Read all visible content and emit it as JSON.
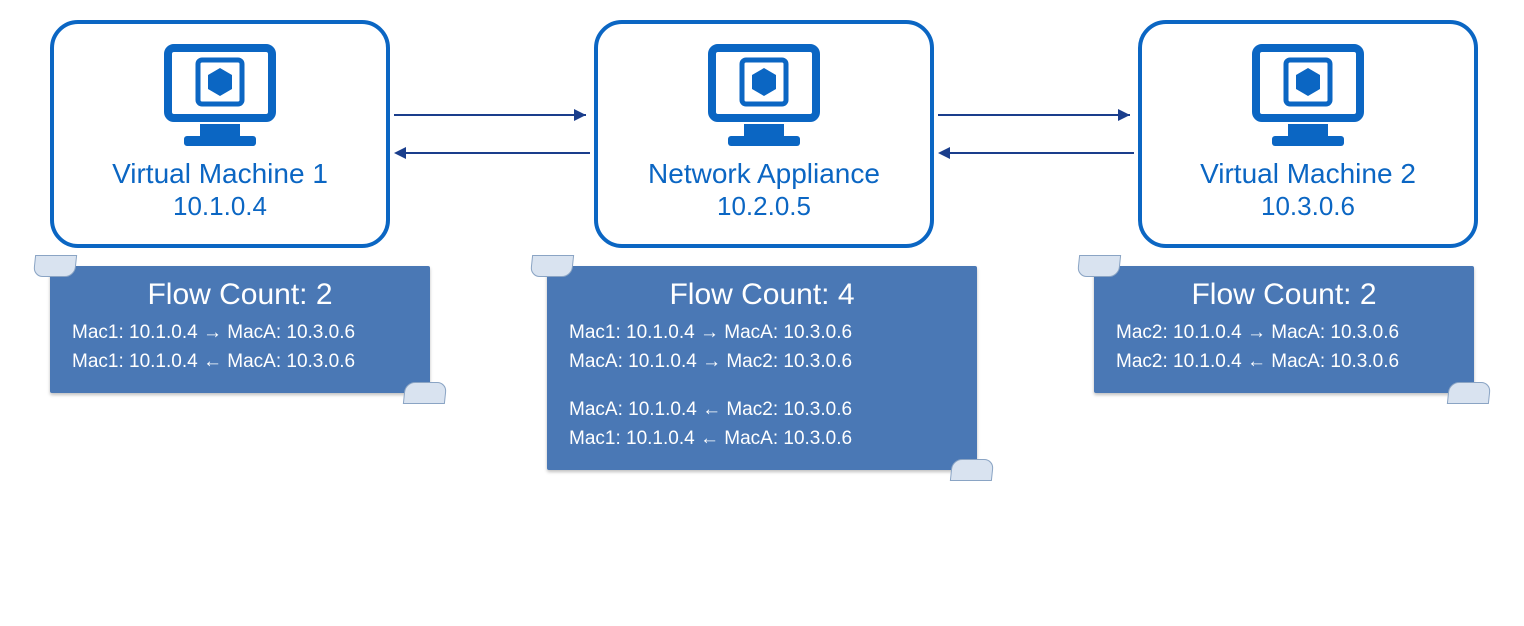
{
  "nodes": {
    "vm1": {
      "title": "Virtual Machine 1",
      "ip": "10.1.0.4"
    },
    "appliance": {
      "title": "Network Appliance",
      "ip": "10.2.0.5"
    },
    "vm2": {
      "title": "Virtual Machine 2",
      "ip": "10.3.0.6"
    }
  },
  "flows": {
    "vm1": {
      "heading": "Flow Count: 2",
      "lines": [
        {
          "left": "Mac1: 10.1.0.4",
          "dir": "→",
          "right": "MacA: 10.3.0.6"
        },
        {
          "left": "Mac1: 10.1.0.4",
          "dir": "←",
          "right": "MacA: 10.3.0.6"
        }
      ]
    },
    "appliance": {
      "heading": "Flow Count: 4",
      "lines_a": [
        {
          "left": "Mac1: 10.1.0.4",
          "dir": "→",
          "right": "MacA: 10.3.0.6"
        },
        {
          "left": "MacA: 10.1.0.4",
          "dir": "→",
          "right": "Mac2: 10.3.0.6"
        }
      ],
      "lines_b": [
        {
          "left": "MacA: 10.1.0.4",
          "dir": "←",
          "right": "Mac2: 10.3.0.6"
        },
        {
          "left": "Mac1: 10.1.0.4",
          "dir": "←",
          "right": "MacA: 10.3.0.6"
        }
      ]
    },
    "vm2": {
      "heading": "Flow Count: 2",
      "lines": [
        {
          "left": "Mac2: 10.1.0.4",
          "dir": "→",
          "right": "MacA: 10.3.0.6"
        },
        {
          "left": "Mac2: 10.1.0.4",
          "dir": "←",
          "right": "MacA: 10.3.0.6"
        }
      ]
    }
  },
  "colors": {
    "primary": "#0b66c3",
    "panel": "#4a78b5"
  }
}
